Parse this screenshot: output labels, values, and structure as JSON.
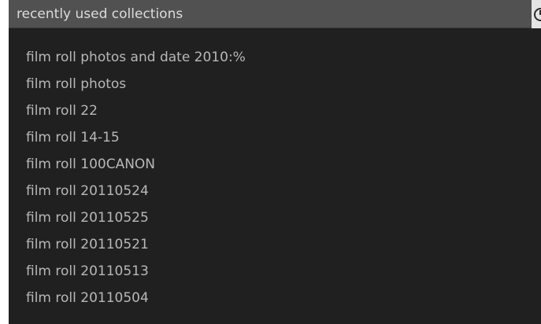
{
  "header": {
    "title": "recently used collections",
    "reset_icon": "reset-icon"
  },
  "collections": [
    "film roll photos and date 2010:%",
    "film roll photos",
    "film roll 22",
    "film roll 14-15",
    "film roll 100CANON",
    "film roll 20110524",
    "film roll 20110525",
    "film roll 20110521",
    "film roll 20110513",
    "film roll 20110504"
  ]
}
